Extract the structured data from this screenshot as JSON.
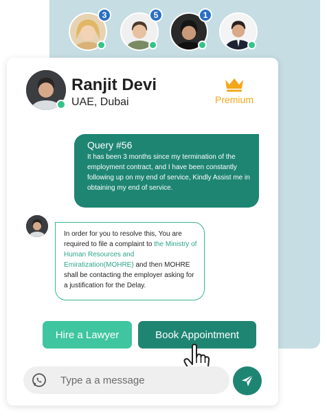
{
  "contacts": [
    {
      "name": "contact-1",
      "badge": "3",
      "online": true
    },
    {
      "name": "contact-2",
      "badge": "5",
      "online": true
    },
    {
      "name": "contact-3",
      "badge": "1",
      "online": true
    },
    {
      "name": "contact-4",
      "badge": "",
      "online": true
    }
  ],
  "profile": {
    "name": "Ranjit Devi",
    "location": "UAE, Dubai",
    "plan_label": "Premium",
    "plan_icon": "crown-icon"
  },
  "query": {
    "title": "Query #56",
    "body": "It has been 3 months since my termination of the employment contract, and I have been constantly following up on my end of service, Kindly Assist me in obtaining my end of service."
  },
  "reply": {
    "text_before": "In order for you to resolve this, You are required to file a complaint to ",
    "highlight": "the Ministry of Human Resources and Emiratization(MOHRE)",
    "text_after": " and then MOHRE shall be contacting the employer asking for a justification for the Delay."
  },
  "actions": {
    "hire_label": "Hire a Lawyer",
    "book_label": "Book Appointment"
  },
  "composer": {
    "placeholder": "Type a a message",
    "left_icon": "whatsapp-icon",
    "send_icon": "send-icon"
  },
  "colors": {
    "teal_dark": "#1f8573",
    "teal_light": "#3fc59f",
    "badge_blue": "#2a6fc6",
    "online_green": "#33c48a",
    "premium_gold": "#f2a71b",
    "back_panel": "#c5dde3"
  }
}
